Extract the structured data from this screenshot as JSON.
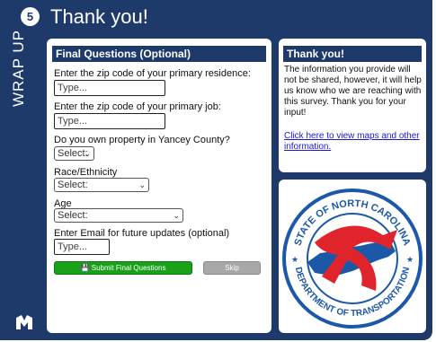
{
  "step": {
    "number": "5",
    "label": "WRAP UP"
  },
  "page_title": "Thank you!",
  "form": {
    "heading": "Final Questions (Optional)",
    "q_zip_residence": {
      "label": "Enter the zip code of your primary residence:",
      "placeholder": "Type..."
    },
    "q_zip_job": {
      "label": "Enter the zip code of your primary job:",
      "placeholder": "Type..."
    },
    "q_property": {
      "label": "Do you own property in Yancey County?",
      "value": "Select:"
    },
    "q_race": {
      "label": "Race/Ethnicity",
      "value": "Select:"
    },
    "q_age": {
      "label": "Age",
      "value": "Select:"
    },
    "q_email": {
      "label": "Enter Email for future updates (optional)",
      "placeholder": "Type..."
    },
    "submit_label": "Submit Final Questions",
    "skip_label": "Skip"
  },
  "thanks_panel": {
    "heading": "Thank you!",
    "body": "The information you provide will not be shared, however, it will help us know who we are reaching with this survey. Thank you for your input!",
    "link": "Click here to view maps and other information."
  },
  "seal": {
    "top_text": "STATE OF NORTH CAROLINA",
    "bottom_text": "DEPARTMENT OF TRANSPORTATION"
  },
  "colors": {
    "navy": "#1d3a6b",
    "submit_green": "#1aa11a",
    "skip_gray": "#a8a8a8",
    "link_blue": "#1a1ad6",
    "seal_red": "#e0242b",
    "seal_blue": "#1c58a8"
  }
}
